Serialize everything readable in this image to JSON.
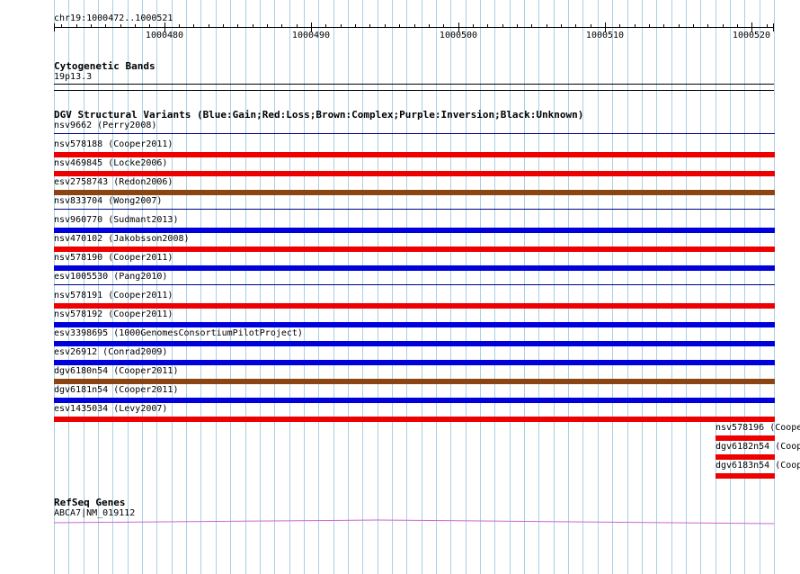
{
  "ruler": {
    "position_label": "chr19:1000472..1000521",
    "ticks": [
      {
        "value": 1000480,
        "label": "1000480"
      },
      {
        "value": 1000490,
        "label": "1000490"
      },
      {
        "value": 1000500,
        "label": "1000500"
      },
      {
        "value": 1000510,
        "label": "1000510"
      },
      {
        "value": 1000520,
        "label": "1000520"
      }
    ]
  },
  "cytoband": {
    "title": "Cytogenetic Bands",
    "band": "19p13.3"
  },
  "dgv": {
    "title": "DGV Structural Variants (Blue:Gain;Red:Loss;Brown:Complex;Purple:Inversion;Black:Unknown)",
    "colors": {
      "gain": "#0000dd",
      "loss": "#ee0000",
      "complex": "#8b4513",
      "none": "#000080"
    },
    "variants": [
      {
        "label": "nsv9662 (Perry2008)",
        "type": "none"
      },
      {
        "label": "nsv578188 (Cooper2011)",
        "type": "loss"
      },
      {
        "label": "nsv469845 (Locke2006)",
        "type": "loss"
      },
      {
        "label": "esv2758743 (Redon2006)",
        "type": "complex"
      },
      {
        "label": "nsv833704 (Wong2007)",
        "type": "none"
      },
      {
        "label": "nsv960770 (Sudmant2013)",
        "type": "gain"
      },
      {
        "label": "nsv470102 (Jakobsson2008)",
        "type": "loss"
      },
      {
        "label": "nsv578190 (Cooper2011)",
        "type": "gain"
      },
      {
        "label": "esv1005530 (Pang2010)",
        "type": "none"
      },
      {
        "label": "nsv578191 (Cooper2011)",
        "type": "loss"
      },
      {
        "label": "nsv578192 (Cooper2011)",
        "type": "gain"
      },
      {
        "label": "esv3398695 (1000GenomesConsortiumPilotProject)",
        "type": "gain"
      },
      {
        "label": "esv26912 (Conrad2009)",
        "type": "gain"
      },
      {
        "label": "dgv6180n54 (Cooper2011)",
        "type": "complex"
      },
      {
        "label": "dgv6181n54 (Cooper2011)",
        "type": "gain"
      },
      {
        "label": "esv1435034 (Levy2007)",
        "type": "loss"
      }
    ],
    "short_variants": [
      {
        "label": "nsv578196 (Coope",
        "type": "loss"
      },
      {
        "label": "dgv6182n54 (Coop",
        "type": "loss"
      },
      {
        "label": "dgv6183n54 (Coop",
        "type": "loss"
      }
    ]
  },
  "refseq": {
    "title": "RefSeq Genes",
    "gene": "ABCA7|NM_019112",
    "gene_color": "#cc66cc"
  },
  "grid_color": "#a8d0e6"
}
